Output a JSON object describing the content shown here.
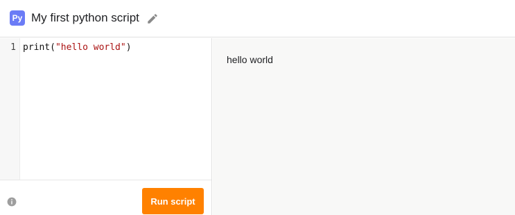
{
  "header": {
    "badge": "Py",
    "title": "My first python script",
    "edit_icon": "pencil-icon"
  },
  "editor": {
    "line_numbers": [
      "1"
    ],
    "code": {
      "function": "print(",
      "string": "\"hello world\"",
      "close": ")"
    }
  },
  "footer": {
    "info_icon": "info-icon",
    "run_label": "Run script"
  },
  "output": {
    "text": "hello world"
  },
  "colors": {
    "badge": "#6b7cf6",
    "run_button": "#ff8100",
    "string": "#aa1111",
    "output_bg": "#f8f8f7"
  }
}
